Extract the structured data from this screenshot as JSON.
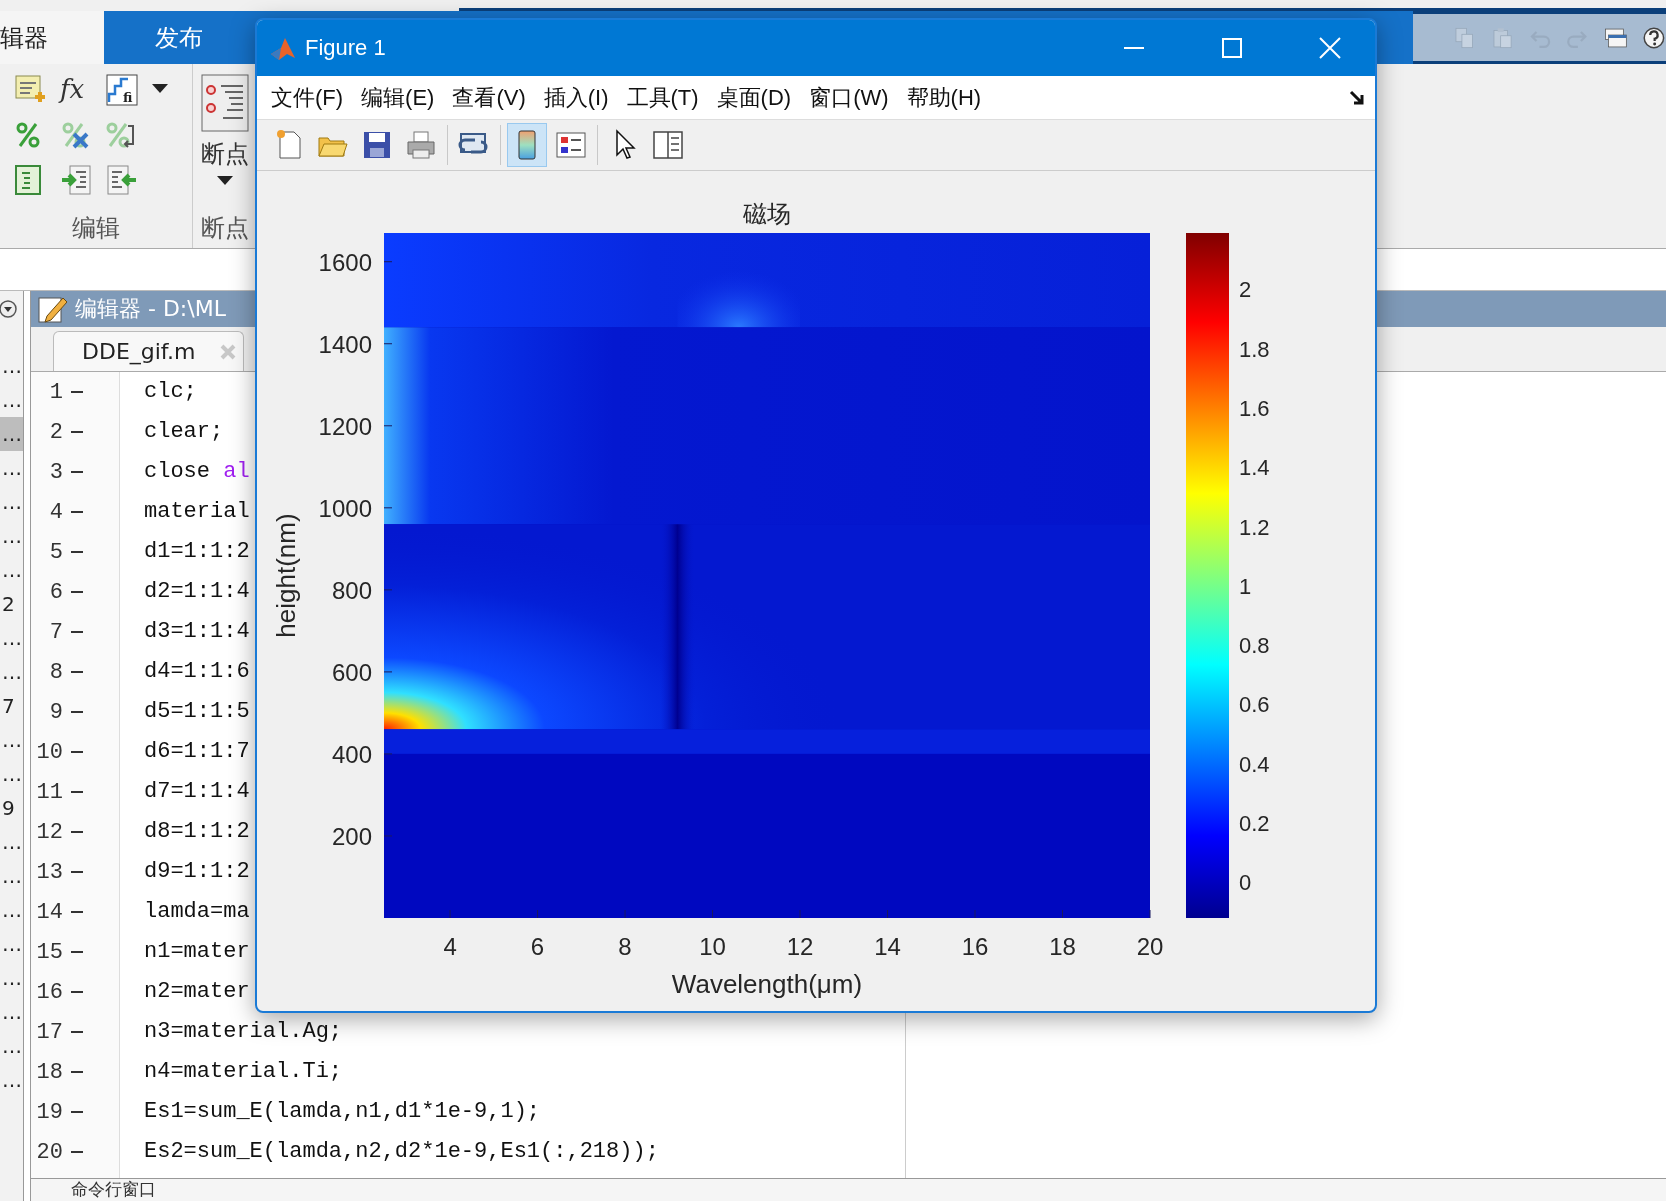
{
  "ribbon": {
    "tabs": [
      {
        "label": "辑器",
        "selected": true
      },
      {
        "label": "发布",
        "selected": false
      }
    ],
    "function_icon": "fx",
    "step_icon": "fi",
    "groups": [
      {
        "label": "编辑"
      },
      {
        "label": "断点",
        "button": "断点"
      }
    ],
    "quick_access": [
      {
        "kind": "copy",
        "disabled": true
      },
      {
        "kind": "paste",
        "disabled": true
      },
      {
        "kind": "undo",
        "disabled": true
      },
      {
        "kind": "redo",
        "disabled": true
      },
      {
        "kind": "windows",
        "disabled": false
      },
      {
        "kind": "help",
        "disabled": false
      }
    ]
  },
  "workspace_strip": {
    "items": [
      {
        "text": "…",
        "selected": false
      },
      {
        "text": "…",
        "selected": false
      },
      {
        "text": "…",
        "selected": true
      },
      {
        "text": "…",
        "selected": false
      },
      {
        "text": "…",
        "selected": false
      },
      {
        "text": "…",
        "selected": false
      },
      {
        "text": "…",
        "selected": false
      },
      {
        "text": "2",
        "selected": false
      },
      {
        "text": "…",
        "selected": false
      },
      {
        "text": "…",
        "selected": false
      },
      {
        "text": "7",
        "selected": false
      },
      {
        "text": "…",
        "selected": false
      },
      {
        "text": "…",
        "selected": false
      },
      {
        "text": "9",
        "selected": false
      },
      {
        "text": "…",
        "selected": false
      },
      {
        "text": "…",
        "selected": false
      },
      {
        "text": "…",
        "selected": false
      },
      {
        "text": "…",
        "selected": false
      },
      {
        "text": "…",
        "selected": false
      },
      {
        "text": "…",
        "selected": false
      },
      {
        "text": "…",
        "selected": false
      },
      {
        "text": "…",
        "selected": false
      }
    ]
  },
  "editor": {
    "title": "编辑器 - D:\\ML",
    "tabs": [
      {
        "label": "DDE_gif.m",
        "selected": true
      }
    ],
    "lines": [
      {
        "number": "1",
        "code": "clc;"
      },
      {
        "number": "2",
        "code": "clear;"
      },
      {
        "number": "3",
        "code": "close ",
        "string": "al"
      },
      {
        "number": "4",
        "code": "material"
      },
      {
        "number": "5",
        "code": "d1=1:1:2"
      },
      {
        "number": "6",
        "code": "d2=1:1:4"
      },
      {
        "number": "7",
        "code": "d3=1:1:4"
      },
      {
        "number": "8",
        "code": "d4=1:1:6"
      },
      {
        "number": "9",
        "code": "d5=1:1:5"
      },
      {
        "number": "10",
        "code": "d6=1:1:7"
      },
      {
        "number": "11",
        "code": "d7=1:1:4"
      },
      {
        "number": "12",
        "code": "d8=1:1:2"
      },
      {
        "number": "13",
        "code": "d9=1:1:2"
      },
      {
        "number": "14",
        "code": "lamda=ma"
      },
      {
        "number": "15",
        "code": "n1=mater"
      },
      {
        "number": "16",
        "code": "n2=mater"
      },
      {
        "number": "17",
        "code": "n3=material.Ag;"
      },
      {
        "number": "18",
        "code": "n4=material.Ti;"
      },
      {
        "number": "19",
        "code": "Es1=sum_E(lamda,n1,d1*1e-9,1);"
      },
      {
        "number": "20",
        "code": "Es2=sum_E(lamda,n2,d2*1e-9,Es1(:,218));"
      }
    ]
  },
  "command_window": {
    "title": "命令行窗口"
  },
  "figure": {
    "title": "Figure 1",
    "menu": [
      "文件(F)",
      "编辑(E)",
      "查看(V)",
      "插入(I)",
      "工具(T)",
      "桌面(D)",
      "窗口(W)",
      "帮助(H)"
    ],
    "toolbar_groups": [
      [
        {
          "kind": "new",
          "on": false
        },
        {
          "kind": "open",
          "on": false
        },
        {
          "kind": "save",
          "on": false
        },
        {
          "kind": "print",
          "on": false
        }
      ],
      [
        {
          "kind": "link",
          "on": false
        }
      ],
      [
        {
          "kind": "colorbar",
          "on": true
        },
        {
          "kind": "legend",
          "on": false
        }
      ],
      [
        {
          "kind": "pointer",
          "on": false
        },
        {
          "kind": "panel",
          "on": false
        }
      ]
    ],
    "plot": {
      "title": "磁场",
      "xlabel": "Wavelength(μm)",
      "ylabel": "height(nm)",
      "x_ticks": [
        "4",
        "6",
        "8",
        "10",
        "12",
        "14",
        "16",
        "18",
        "20"
      ],
      "y_ticks": [
        "1600",
        "1400",
        "1200",
        "1000",
        "800",
        "600",
        "400",
        "200"
      ],
      "colorbar_ticks": [
        "2",
        "1.8",
        "1.6",
        "1.4",
        "1.2",
        "1",
        "0.8",
        "0.6",
        "0.4",
        "0.2",
        "0"
      ]
    }
  }
}
